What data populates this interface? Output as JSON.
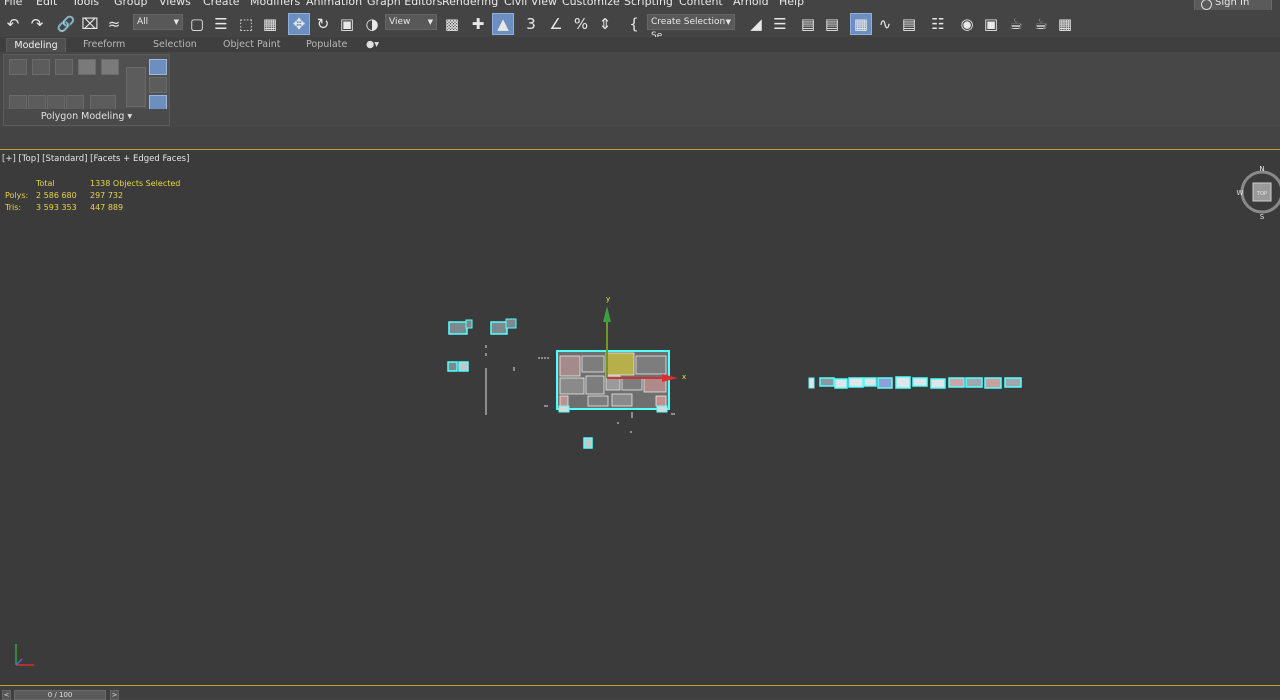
{
  "menu": {
    "items": [
      "File",
      "Edit",
      "Tools",
      "Group",
      "Views",
      "Create",
      "Modifiers",
      "Animation",
      "Graph Editors",
      "Rendering",
      "Civil View",
      "Customize",
      "Scripting",
      "Content",
      "Arnold",
      "Help"
    ],
    "sign_in": "Sign In"
  },
  "toolbar": {
    "selection_filter": "All",
    "ref_coord": "View",
    "named_selection": "Create Selection Se",
    "icons": [
      "undo-icon",
      "redo-icon",
      "link-icon",
      "unlink-icon",
      "bind-spacewarp-icon",
      "select-object-icon",
      "select-by-name-icon",
      "rect-region-icon",
      "window-crossing-icon",
      "move-icon",
      "rotate-icon",
      "scale-icon",
      "placement-icon",
      "pivot-icon",
      "snap-3d-icon",
      "angle-snap-icon",
      "percent-snap-icon",
      "spinner-snap-icon",
      "edit-named-sel-icon",
      "mirror-icon",
      "align-icon",
      "layer-explorer-icon",
      "scene-explorer-icon",
      "ribbon-toggle-icon",
      "curve-editor-icon",
      "dope-sheet-icon",
      "schematic-icon",
      "material-editor-icon",
      "render-setup-icon",
      "render-frame-icon",
      "render-icon",
      "render-iterative-icon"
    ]
  },
  "ribbon": {
    "tabs": [
      "Modeling",
      "Freeform",
      "Selection",
      "Object Paint",
      "Populate"
    ],
    "active_tab": "Modeling",
    "panel_label": "Polygon Modeling"
  },
  "viewport": {
    "label": "[+] [Top] [Standard] [Facets + Edged Faces]",
    "stats": {
      "header_total": "Total",
      "header_selected": "1338 Objects Selected",
      "polys_label": "Polys:",
      "polys_total": "2 586 680",
      "polys_selected": "297 732",
      "tris_label": "Tris:",
      "tris_total": "3 593 353",
      "tris_selected": "447 889"
    },
    "viewcube": {
      "n": "N",
      "s": "S",
      "w": "W",
      "face": "TOP"
    },
    "gizmo_x": "x",
    "gizmo_y": "y"
  },
  "timeslider": {
    "frame": "0 / 100",
    "prev": "<",
    "next": ">"
  }
}
